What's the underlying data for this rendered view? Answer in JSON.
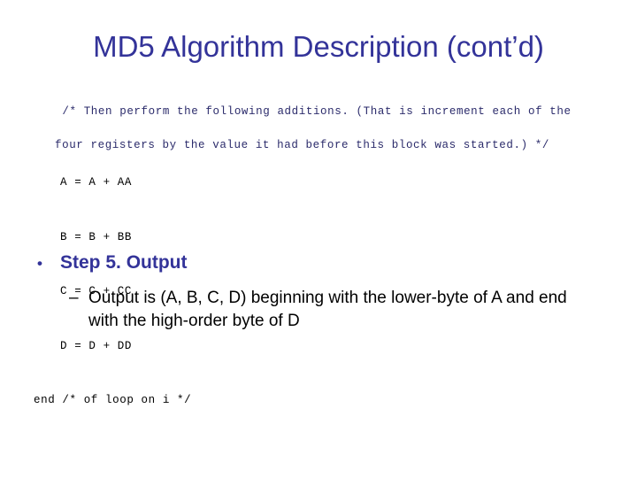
{
  "slide": {
    "title": "MD5 Algorithm Description (cont’d)",
    "code_comment": {
      "line1": "/* Then perform the following additions. (That is increment each of the",
      "line2": "four registers by the value it had before this block was started.) */"
    },
    "code_block": {
      "lines": [
        "A = A + AA",
        "B = B + BB",
        "C = C + CC",
        "D = D + DD"
      ],
      "end_line": "end /* of loop on i */"
    },
    "bullets": [
      {
        "marker": "•",
        "text": "Step 5. Output",
        "level": 1
      },
      {
        "marker": "–",
        "text": "Output is (A, B, C, D) beginning with the lower-byte of A and end with the high-order byte of D",
        "level": 2
      }
    ]
  },
  "colors": {
    "title": "#333399",
    "comment": "#2b2b6b",
    "code": "#000000",
    "bullet_level1": "#333399",
    "bullet_level2": "#000000",
    "background": "#ffffff"
  }
}
